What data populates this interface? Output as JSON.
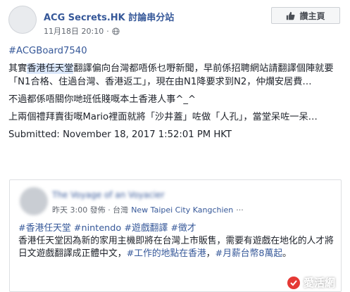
{
  "header": {
    "page_name": "ACG Secrets.HK 討論串分站",
    "date": "11月18日 20:10",
    "separator": "·",
    "like_label": "讚主頁"
  },
  "post": {
    "hashtag": "#ACGBoard7540",
    "para1_a": "其實",
    "para1_highlight": "香港任天堂",
    "para1_b": "翻譯偏向台灣都唔係乜嘢新聞，早前係招聘網站請翻譯個陣就要「N1合格、住過台灣、香港返工」，現在由N1降要求到N2，仲爛安居費…",
    "para2": "不過都係唔關你哋班低賤嘅本土香港人事^_^",
    "para3": "上兩個禮拜賣街嘅Mario裡面就將「沙井蓋」咗做「人孔」，當堂呆咗一呆…",
    "submitted": "Submitted: November 18, 2017 1:52:01 PM HKT"
  },
  "shared": {
    "name_blurred": "The Voyage of an Voyacier",
    "time": "昨天 3:00 發佈 · 台灣",
    "location": "New Taipei City Kangchien",
    "ellipsis": "···",
    "tags": [
      "#香港任天堂",
      "#nintendo",
      "#遊戲翻譯",
      "#徵才"
    ],
    "text_a": "香港任天堂因為新的家用主機即將在台灣上市販售，需要有遊戲在地化的人才將日文遊戲翻譯成正體中文，",
    "text_tag1": "#工作的地點在香港",
    "text_mid": "，",
    "text_tag2": "#月薪台幣8萬起",
    "text_end": "。"
  },
  "watermark": {
    "text": "愛活網"
  },
  "colors": {
    "link": "#365899",
    "highlight": "#dbe8fb",
    "border": "#dddfe2"
  }
}
